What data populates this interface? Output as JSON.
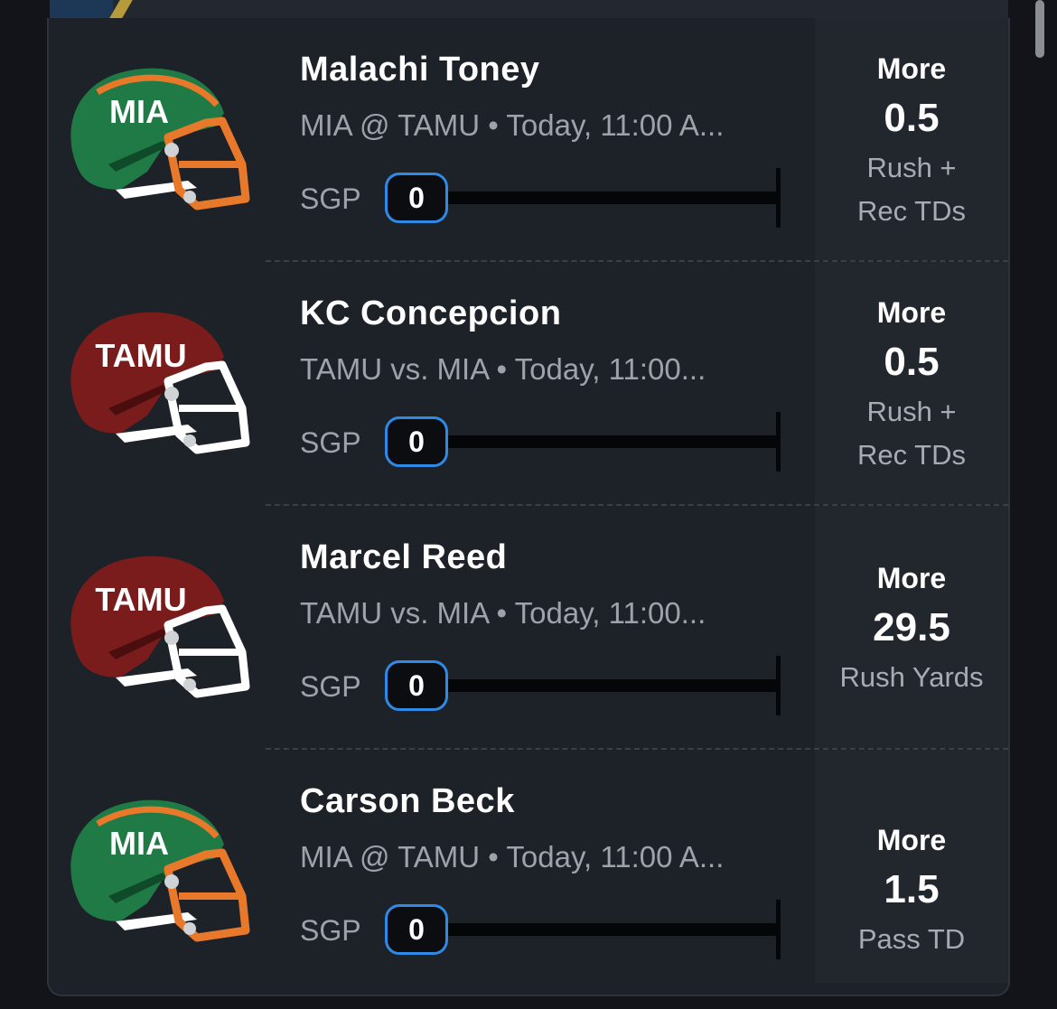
{
  "colors": {
    "page_bg": "#121419",
    "card_bg": "#1d2128",
    "projection_bg": "#22262d",
    "sgp_accent": "#2f8ae6",
    "mia_green": "#1f7a45",
    "mia_orange": "#e8782a",
    "tamu_maroon": "#7a1c1c"
  },
  "picks": [
    {
      "helmet_team": "MIA",
      "helmet_icon": "helmet-icon-mia",
      "player": "Malachi Toney",
      "game": "MIA @ TAMU • Today, 11:00 A...",
      "sgp_label": "SGP",
      "sgp_count": "0",
      "direction": "More",
      "line": "0.5",
      "stat_line1": "Rush  +",
      "stat_line2": "Rec TDs"
    },
    {
      "helmet_team": "TAMU",
      "helmet_icon": "helmet-icon-tamu",
      "player": "KC Concepcion",
      "game": "TAMU vs. MIA • Today, 11:00...",
      "sgp_label": "SGP",
      "sgp_count": "0",
      "direction": "More",
      "line": "0.5",
      "stat_line1": "Rush  +",
      "stat_line2": "Rec TDs"
    },
    {
      "helmet_team": "TAMU",
      "helmet_icon": "helmet-icon-tamu",
      "player": "Marcel Reed",
      "game": "TAMU vs. MIA • Today, 11:00...",
      "sgp_label": "SGP",
      "sgp_count": "0",
      "direction": "More",
      "line": "29.5",
      "stat_line1": "Rush Yards",
      "stat_line2": ""
    },
    {
      "helmet_team": "MIA",
      "helmet_icon": "helmet-icon-mia",
      "player": "Carson Beck",
      "game": "MIA @ TAMU • Today, 11:00 A...",
      "sgp_label": "SGP",
      "sgp_count": "0",
      "direction": "More",
      "line": "1.5",
      "stat_line1": "Pass TD",
      "stat_line2": ""
    }
  ]
}
